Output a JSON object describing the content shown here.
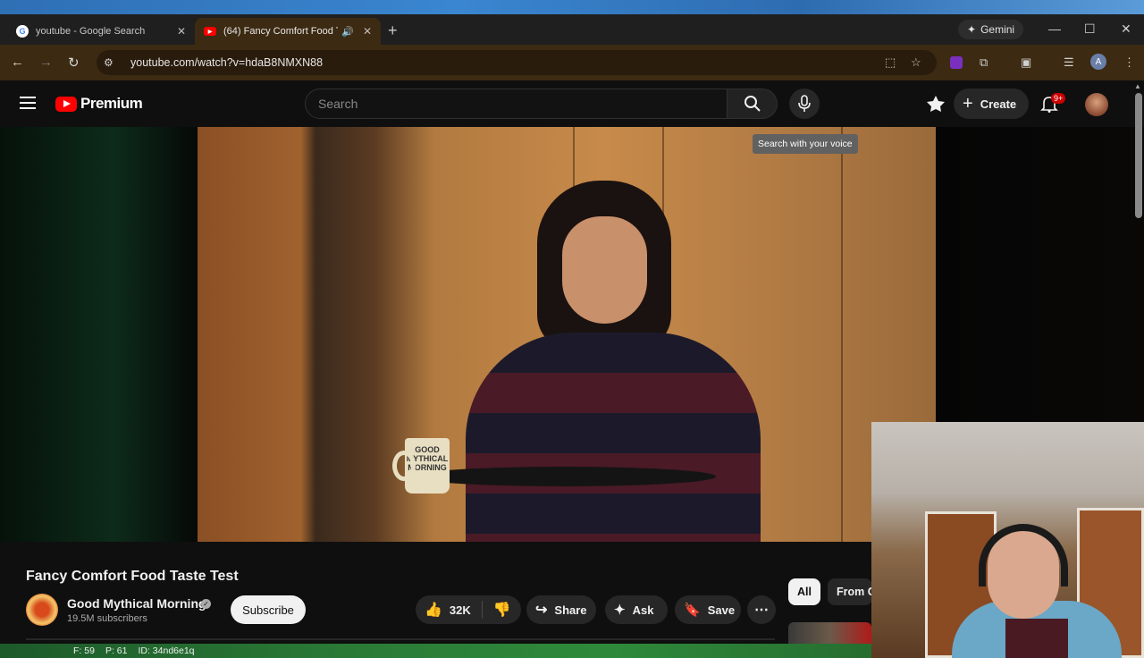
{
  "browser": {
    "tabs": [
      {
        "title": "youtube - Google Search",
        "active": false
      },
      {
        "title": "(64) Fancy Comfort Food Ta",
        "active": true
      }
    ],
    "gemini_label": "Gemini",
    "url": "youtube.com/watch?v=hdaB8NMXN88",
    "profile_initial": "A"
  },
  "youtube": {
    "brand": "Premium",
    "search": {
      "placeholder": "Search"
    },
    "mic_tooltip": "Search with your voice",
    "create_label": "Create",
    "notifications_badge": "9+",
    "video": {
      "mug_text": "GOOD MYTHICAL MORNING",
      "title": "Fancy Comfort Food Taste Test",
      "channel": "Good Mythical Morning",
      "subscribers": "19.5M subscribers",
      "subscribe_label": "Subscribe",
      "likes": "32K",
      "share_label": "Share",
      "ask_label": "Ask",
      "save_label": "Save"
    },
    "chips": [
      "All",
      "From G"
    ]
  },
  "overlay_status": {
    "f": "F: 59",
    "p": "P: 61",
    "id": "ID: 34nd6e1q"
  },
  "colors": {
    "brand_red": "#ff0000",
    "active_tab": "#3c2a12",
    "badge_red": "#cc0000"
  }
}
